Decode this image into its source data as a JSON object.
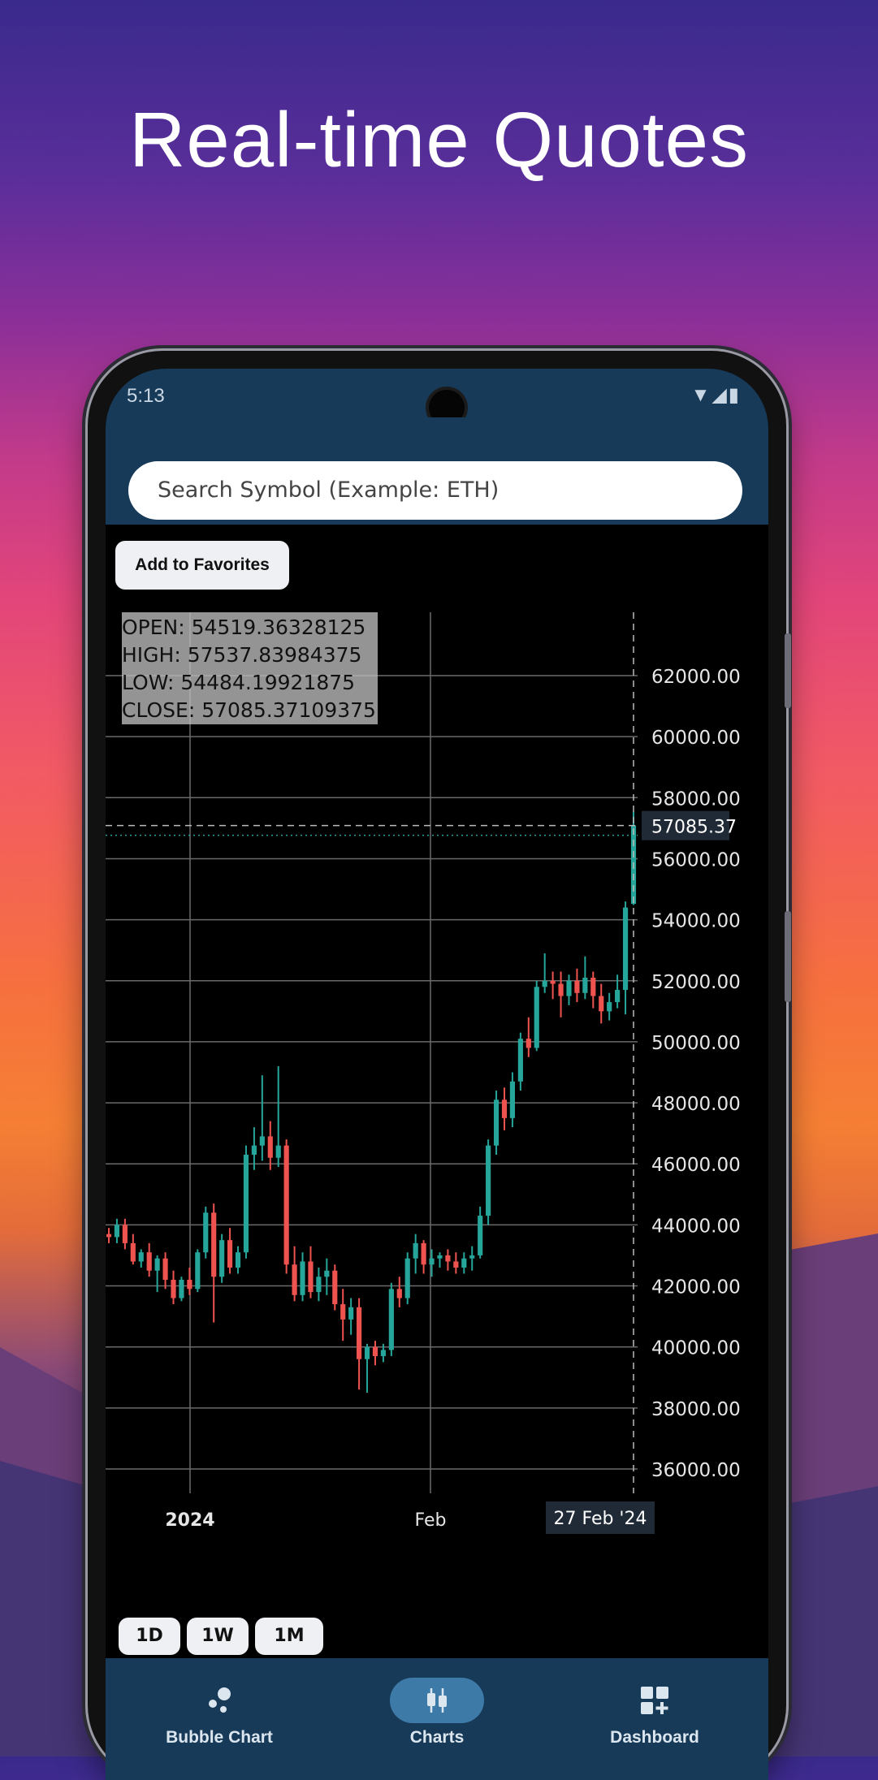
{
  "headline": "Real-time Quotes",
  "status": {
    "time": "5:13",
    "icons": "▼◢▮"
  },
  "search": {
    "placeholder": "Search Symbol (Example: ETH)"
  },
  "favorites_button": "Add to Favorites",
  "ohlc": {
    "open": "OPEN: 54519.36328125",
    "high": "HIGH: 57537.83984375",
    "low": "LOW: 54484.19921875",
    "close": "CLOSE: 57085.37109375"
  },
  "timeframes": [
    "1D",
    "1W",
    "1M"
  ],
  "nav": {
    "bubble": "Bubble Chart",
    "charts": "Charts",
    "dashboard": "Dashboard"
  },
  "icons": {
    "bubble": "bubble-icon",
    "charts": "candlestick-icon",
    "dashboard": "dashboard-add-icon"
  },
  "colors": {
    "up": "#26a69a",
    "down": "#ef5350",
    "bar_bg": "#173a58",
    "accent_pill": "#3d7aa8"
  },
  "chart_data": {
    "type": "candlestick",
    "ylim": [
      35000,
      63000
    ],
    "y_ticks": [
      "62000.00",
      "60000.00",
      "58000.00",
      "56000.00",
      "54000.00",
      "52000.00",
      "50000.00",
      "48000.00",
      "46000.00",
      "44000.00",
      "42000.00",
      "40000.00",
      "38000.00",
      "36000.00"
    ],
    "x_labels": [
      "2024",
      "Feb"
    ],
    "crosshair_date": "27 Feb '24",
    "last_price": "57085.37",
    "grid": true,
    "ohlc": [
      [
        43700,
        43900,
        43400,
        43600
      ],
      [
        43600,
        44200,
        43400,
        44000
      ],
      [
        44000,
        44200,
        43200,
        43400
      ],
      [
        43400,
        43700,
        42700,
        42800
      ],
      [
        42800,
        43200,
        42600,
        43100
      ],
      [
        43100,
        43400,
        42300,
        42500
      ],
      [
        42500,
        43000,
        41800,
        42900
      ],
      [
        42900,
        43100,
        41900,
        42200
      ],
      [
        42200,
        42500,
        41400,
        41600
      ],
      [
        41600,
        42300,
        41500,
        42200
      ],
      [
        42200,
        42600,
        41700,
        41900
      ],
      [
        41900,
        43200,
        41800,
        43100
      ],
      [
        43100,
        44600,
        42900,
        44400
      ],
      [
        44400,
        44700,
        40800,
        42300
      ],
      [
        42300,
        43700,
        42100,
        43500
      ],
      [
        43500,
        43900,
        42400,
        42600
      ],
      [
        42600,
        43300,
        42400,
        43100
      ],
      [
        43100,
        46600,
        42900,
        46300
      ],
      [
        46300,
        47200,
        45800,
        46600
      ],
      [
        46600,
        48900,
        46100,
        46900
      ],
      [
        46900,
        47400,
        45800,
        46200
      ],
      [
        46200,
        49200,
        45900,
        46600
      ],
      [
        46600,
        46800,
        42400,
        42700
      ],
      [
        42700,
        43300,
        41500,
        41700
      ],
      [
        41700,
        43100,
        41500,
        42800
      ],
      [
        42800,
        43300,
        41600,
        41800
      ],
      [
        41800,
        42600,
        41500,
        42300
      ],
      [
        42300,
        42900,
        41700,
        42500
      ],
      [
        42500,
        42700,
        41200,
        41400
      ],
      [
        41400,
        41900,
        40200,
        40900
      ],
      [
        40900,
        41600,
        40400,
        41300
      ],
      [
        41300,
        41600,
        38600,
        39600
      ],
      [
        39600,
        40100,
        38500,
        40000
      ],
      [
        40000,
        40200,
        39400,
        39700
      ],
      [
        39700,
        40100,
        39500,
        39900
      ],
      [
        39900,
        42100,
        39700,
        41900
      ],
      [
        41900,
        42300,
        41300,
        41600
      ],
      [
        41600,
        43100,
        41400,
        42900
      ],
      [
        42900,
        43700,
        42400,
        43400
      ],
      [
        43400,
        43500,
        42400,
        42700
      ],
      [
        42700,
        43200,
        42300,
        42900
      ],
      [
        42900,
        43100,
        42600,
        43000
      ],
      [
        43000,
        43200,
        42500,
        42800
      ],
      [
        42800,
        43100,
        42400,
        42600
      ],
      [
        42600,
        43100,
        42400,
        42900
      ],
      [
        42900,
        43300,
        42500,
        43000
      ],
      [
        43000,
        44600,
        42900,
        44300
      ],
      [
        44300,
        46800,
        44000,
        46600
      ],
      [
        46600,
        48400,
        46300,
        48100
      ],
      [
        48100,
        48500,
        47100,
        47500
      ],
      [
        47500,
        49000,
        47200,
        48700
      ],
      [
        48700,
        50300,
        48400,
        50100
      ],
      [
        50100,
        50800,
        49500,
        49800
      ],
      [
        49800,
        52000,
        49700,
        51800
      ],
      [
        51800,
        52900,
        51600,
        52000
      ],
      [
        52000,
        52300,
        51400,
        51900
      ],
      [
        51900,
        52300,
        50800,
        51500
      ],
      [
        51500,
        52200,
        51200,
        52000
      ],
      [
        52000,
        52400,
        51300,
        51600
      ],
      [
        51600,
        52800,
        51400,
        52100
      ],
      [
        52100,
        52300,
        51100,
        51500
      ],
      [
        51500,
        51900,
        50600,
        51000
      ],
      [
        51000,
        51600,
        50700,
        51300
      ],
      [
        51300,
        52200,
        51100,
        51700
      ],
      [
        51700,
        54600,
        50900,
        54400
      ],
      [
        54519,
        57538,
        54484,
        57085
      ]
    ]
  }
}
